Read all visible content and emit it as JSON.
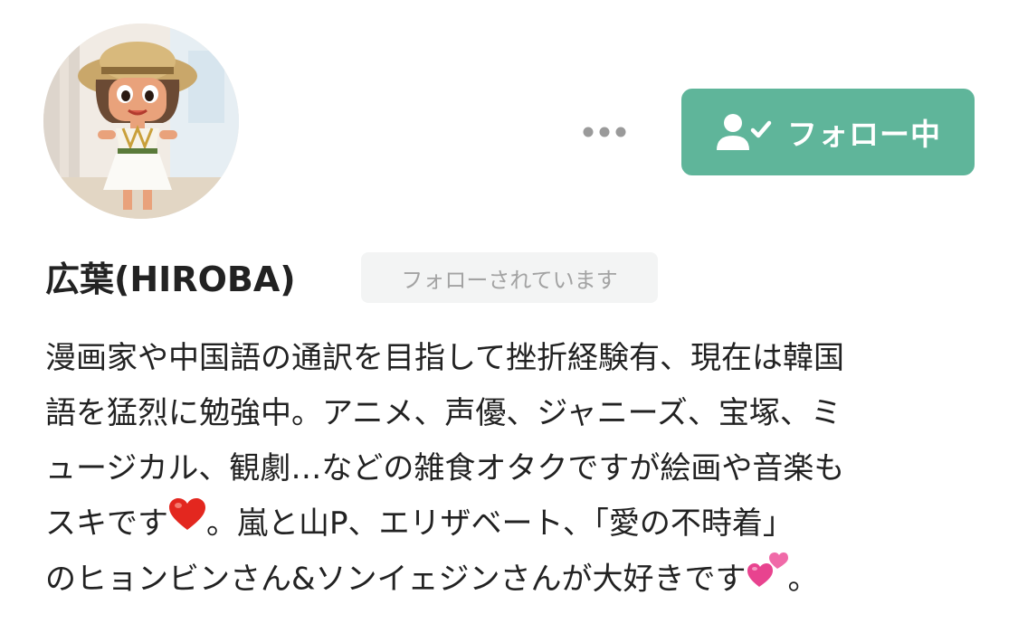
{
  "profile": {
    "avatar_alt": "avatar",
    "name": "広葉(HIROBA)",
    "follows_you_label": "フォローされています"
  },
  "actions": {
    "more_icon": "more-horizontal-icon",
    "follow_icon": "user-check-icon",
    "follow_label": "フォロー中"
  },
  "bio": {
    "lines": [
      {
        "text": "漫画家や中国語の通訳を目指して挫折経験有、現在は韓国"
      },
      {
        "text": "語を猛烈に勉強中。アニメ、声優、ジャニーズ、宝塚、ミ"
      },
      {
        "text": "ュージカル、観劇…などの雑食オタクですが絵画や音楽も"
      },
      {
        "text_before": "スキです",
        "emoji": "red-heart-emoji",
        "text_after": "。嵐と山P、エリザベート、「愛の不時着」"
      },
      {
        "text_before": "のヒョンビンさん&ソンイェジンさんが大好きです",
        "emoji": "two-hearts-emoji",
        "text_after": "。"
      }
    ]
  },
  "colors": {
    "accent": "#5fb59a",
    "badge_background": "#f3f4f4",
    "badge_text": "#a3a3a3",
    "more_dots": "#9a9a9a"
  }
}
